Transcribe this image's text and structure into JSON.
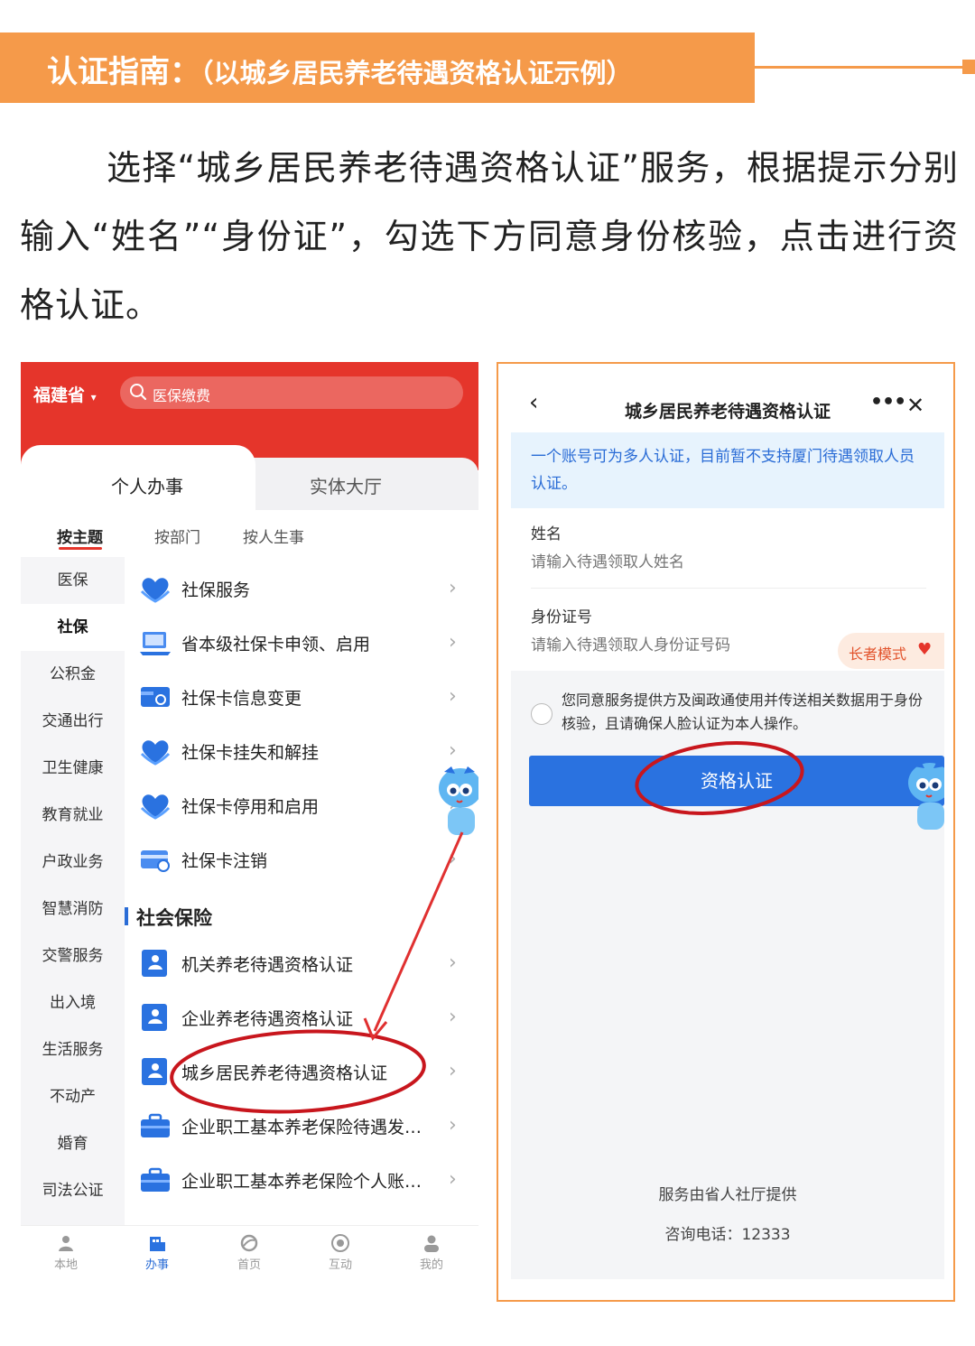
{
  "banner": {
    "title": "认证指南：",
    "subtitle": "（以城乡居民养老待遇资格认证示例）"
  },
  "intro": "选择“城乡居民养老待遇资格认证”服务，根据提示分别输入“姓名”“身份证”，勾选下方同意身份核验，点击进行资格认证。",
  "left_phone": {
    "province": "福建省",
    "search_placeholder": "医保缴费",
    "tabs": [
      "个人办事",
      "实体大厅"
    ],
    "subtabs": [
      "按主题",
      "按部门",
      "按人生事"
    ],
    "categories": [
      "医保",
      "社保",
      "公积金",
      "交通出行",
      "卫生健康",
      "教育就业",
      "户政业务",
      "智慧消防",
      "交警服务",
      "出入境",
      "生活服务",
      "不动产",
      "婚育",
      "司法公证"
    ],
    "active_category": "社保",
    "items": [
      {
        "label": "社保服务",
        "icon": "heart-hands-icon"
      },
      {
        "label": "省本级社保卡申领、启用",
        "icon": "computer-icon"
      },
      {
        "label": "社保卡信息变更",
        "icon": "card-change-icon"
      },
      {
        "label": "社保卡挂失和解挂",
        "icon": "heart-hands-icon"
      },
      {
        "label": "社保卡停用和启用",
        "icon": "heart-hands-icon"
      },
      {
        "label": "社保卡注销",
        "icon": "card-icon"
      }
    ],
    "section_title": "社会保险",
    "section_items": [
      {
        "label": "机关养老待遇资格认证",
        "icon": "person-book-icon"
      },
      {
        "label": "企业养老待遇资格认证",
        "icon": "person-book-icon"
      },
      {
        "label": "城乡居民养老待遇资格认证",
        "icon": "person-book-icon"
      },
      {
        "label": "企业职工基本养老保险待遇发…",
        "icon": "briefcase-icon"
      },
      {
        "label": "企业职工基本养老保险个人账…",
        "icon": "briefcase-icon"
      }
    ],
    "bottom_nav": [
      {
        "label": "本地",
        "icon": "location-person-icon"
      },
      {
        "label": "办事",
        "icon": "building-icon"
      },
      {
        "label": "首页",
        "icon": "home-logo-icon"
      },
      {
        "label": "互动",
        "icon": "hotline-icon"
      },
      {
        "label": "我的",
        "icon": "user-icon"
      }
    ],
    "active_nav": "办事"
  },
  "right_phone": {
    "title": "城乡居民养老待遇资格认证",
    "notice": "一个账号可为多人认证，目前暂不支持厦门待遇领取人员认证。",
    "name_label": "姓名",
    "name_placeholder": "请输入待遇领取人姓名",
    "id_label": "身份证号",
    "id_placeholder": "请输入待遇领取人身份证号码",
    "elder_mode": "长者模式",
    "consent": "您同意服务提供方及闽政通使用并传送相关数据用于身份核验，且请确保人脸认证为本人操作。",
    "submit": "资格认证",
    "footer_provider": "服务由省人社厅提供",
    "footer_phone": "咨询电话：12333"
  },
  "colors": {
    "banner": "#f59a4a",
    "app_red": "#e5352b",
    "primary_blue": "#2a72e0",
    "annotation_red": "#c8161d"
  }
}
